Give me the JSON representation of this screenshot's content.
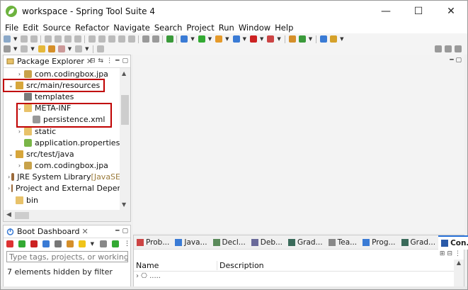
{
  "window": {
    "title": "workspace - Spring Tool Suite 4",
    "minimize": "—",
    "maximize": "☐",
    "close": "✕"
  },
  "menu": [
    "File",
    "Edit",
    "Source",
    "Refactor",
    "Navigate",
    "Search",
    "Project",
    "Run",
    "Window",
    "Help"
  ],
  "package_explorer": {
    "title": "Package Explorer",
    "tree": [
      {
        "label": "com.codingbox.jpa",
        "twisty": "›",
        "icon": "package-icon",
        "indent": 2
      },
      {
        "label": "src/main/resources",
        "twisty": "⌄",
        "icon": "source-folder-icon",
        "indent": 1
      },
      {
        "label": "templates",
        "twisty": "",
        "icon": "folder-grid-icon",
        "indent": 2
      },
      {
        "label": "META-INF",
        "twisty": "⌄",
        "icon": "folder-icon",
        "indent": 2
      },
      {
        "label": "persistence.xml",
        "twisty": "",
        "icon": "xml-file-icon",
        "indent": 3
      },
      {
        "label": "static",
        "twisty": "›",
        "icon": "folder-icon",
        "indent": 2
      },
      {
        "label": "application.properties",
        "twisty": "",
        "icon": "properties-file-icon",
        "indent": 2
      },
      {
        "label": "src/test/java",
        "twisty": "⌄",
        "icon": "source-folder-icon",
        "indent": 1
      },
      {
        "label": "com.codingbox.jpa",
        "twisty": "›",
        "icon": "package-icon",
        "indent": 2
      },
      {
        "label": "JRE System Library ",
        "suffix": "[JavaSE",
        "twisty": "›",
        "icon": "library-icon",
        "indent": 1
      },
      {
        "label": "Project and External Deper",
        "twisty": "›",
        "icon": "library-icon",
        "indent": 1
      },
      {
        "label": "bin",
        "twisty": "",
        "icon": "folder-icon",
        "indent": 1
      }
    ]
  },
  "boot_dashboard": {
    "title": "Boot Dashboard",
    "search_placeholder": "Type tags, projects, or working set n",
    "hidden_note": "7 elements hidden by filter"
  },
  "bottom_panel": {
    "tabs": [
      {
        "label": "Prob...",
        "icon": "problems-icon"
      },
      {
        "label": "Java...",
        "icon": "javadoc-icon"
      },
      {
        "label": "Decl...",
        "icon": "declaration-icon"
      },
      {
        "label": "Deb...",
        "icon": "debug-icon"
      },
      {
        "label": "Grad...",
        "icon": "gradle-icon"
      },
      {
        "label": "Tea...",
        "icon": "team-icon"
      },
      {
        "label": "Prog...",
        "icon": "progress-icon"
      },
      {
        "label": "Grad...",
        "icon": "gradle-icon"
      },
      {
        "label": "Con...",
        "icon": "console-icon",
        "active": true
      }
    ],
    "columns": [
      "Name",
      "Description"
    ],
    "partial_row": "› ⎔ ....."
  },
  "colors": {
    "highlight": "#c00000",
    "spring_green": "#6db33f",
    "active_tab": "#2a73d9"
  }
}
